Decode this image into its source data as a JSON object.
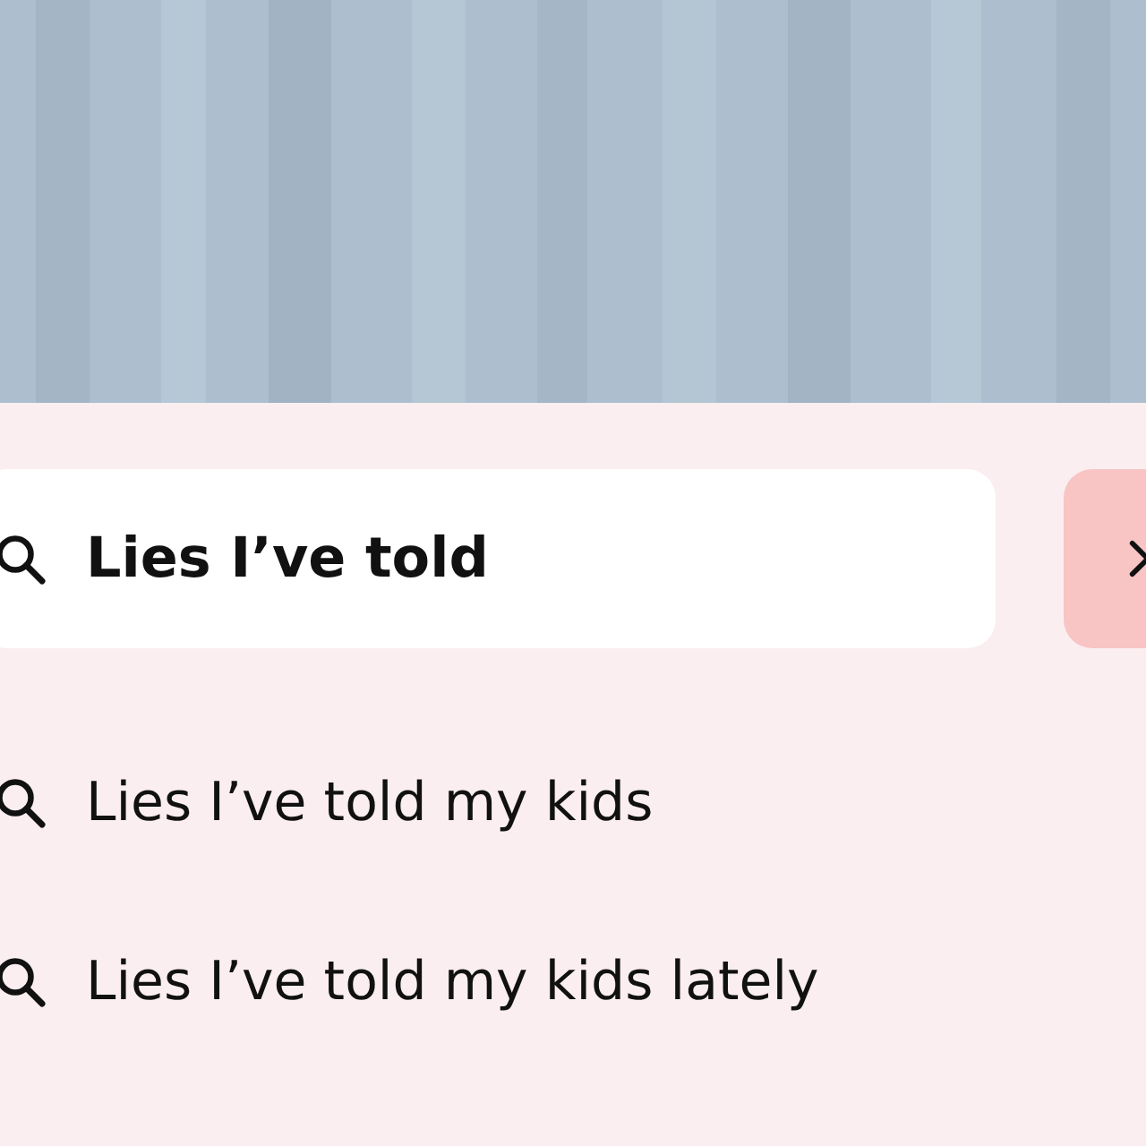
{
  "search": {
    "value": "Lies I’ve told"
  },
  "suggestions": [
    {
      "text": "Lies I’ve told my kids"
    },
    {
      "text": "Lies I’ve told my kids lately"
    }
  ]
}
